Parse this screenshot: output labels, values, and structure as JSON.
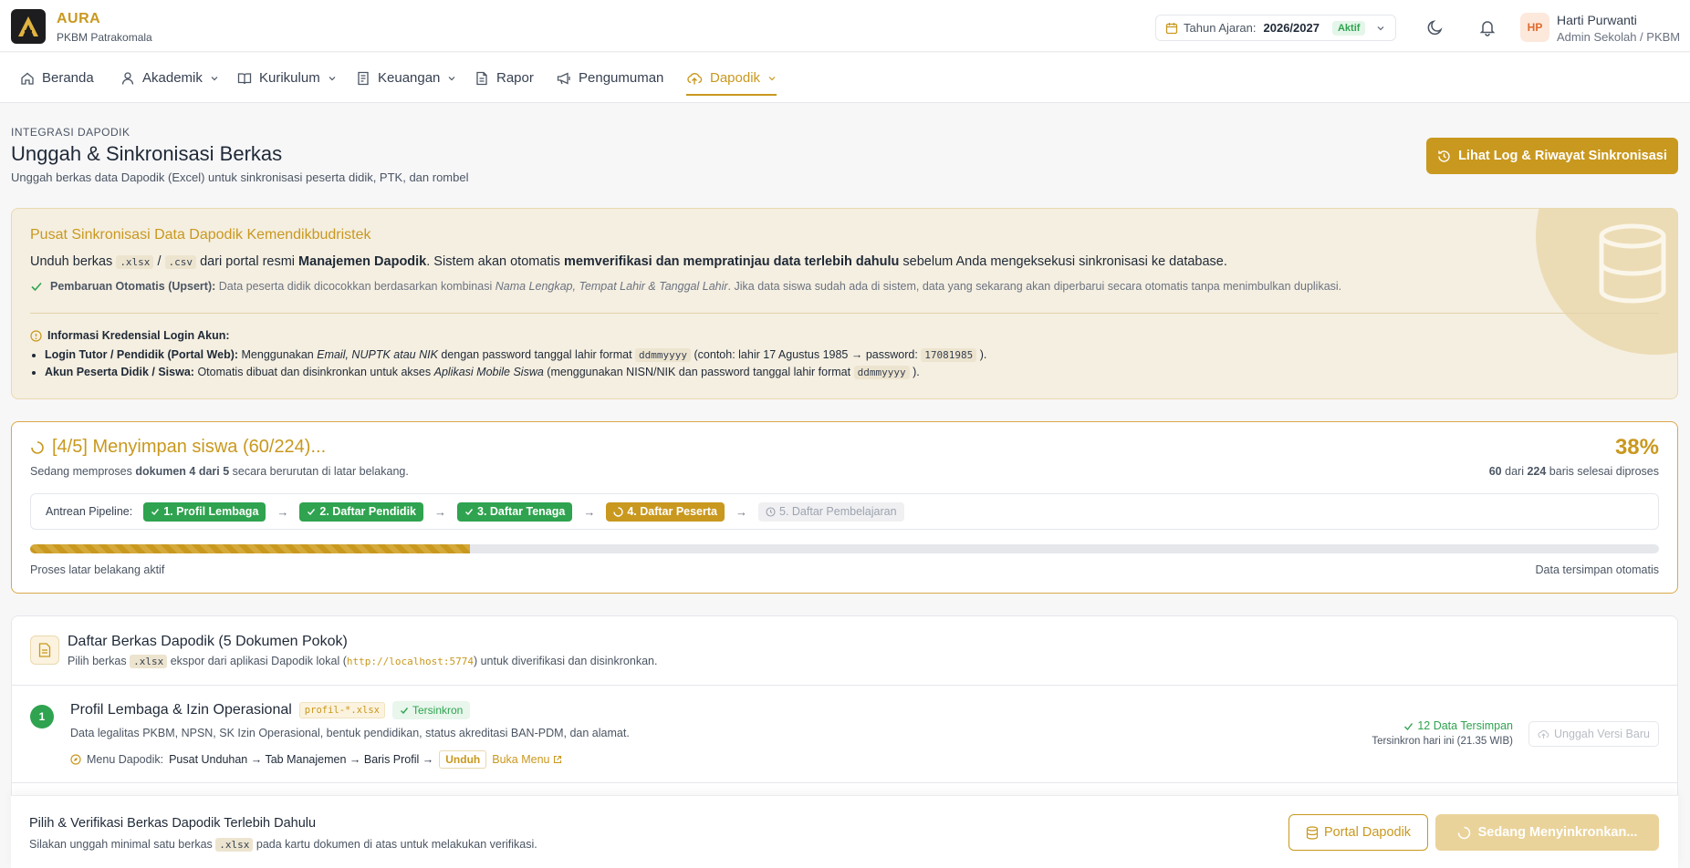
{
  "brand": {
    "name": "AURA",
    "org": "PKBM Patrakomala"
  },
  "academic_year": {
    "label": "Tahun Ajaran:",
    "value": "2026/2027",
    "status": "Aktif"
  },
  "user": {
    "initials": "HP",
    "name": "Harti Purwanti",
    "role": "Admin Sekolah / PKBM"
  },
  "nav": [
    {
      "label": "Beranda",
      "icon": "home-icon"
    },
    {
      "label": "Akademik",
      "icon": "user-icon"
    },
    {
      "label": "Kurikulum",
      "icon": "book-icon"
    },
    {
      "label": "Keuangan",
      "icon": "receipt-icon"
    },
    {
      "label": "Rapor",
      "icon": "document-icon"
    },
    {
      "label": "Pengumuman",
      "icon": "megaphone-icon"
    },
    {
      "label": "Dapodik",
      "icon": "cloud-upload-icon",
      "active": true
    }
  ],
  "page": {
    "eyebrow": "INTEGRASI DAPODIK",
    "title": "Unggah & Sinkronisasi Berkas",
    "subtitle": "Unggah berkas data Dapodik (Excel) untuk sinkronisasi peserta didik, PTK, dan rombel",
    "log_button": "Lihat Log & Riwayat Sinkronisasi"
  },
  "info": {
    "title": "Pusat Sinkronisasi Data Dapodik Kemendikbudristek",
    "line1_a": "Unduh berkas",
    "ext_xlsx": ".xlsx",
    "slash": "/",
    "ext_csv": ".csv",
    "line1_b": "dari portal resmi",
    "line1_c": "Manajemen Dapodik",
    "line1_d": ". Sistem akan otomatis",
    "line1_e": "memverifikasi dan mempratinjau data terlebih dahulu",
    "line1_f": "sebelum Anda mengeksekusi sinkronisasi ke database.",
    "upsert_label": "Pembaruan Otomatis (Upsert):",
    "upsert_a": "Data peserta didik dicocokkan berdasarkan kombinasi",
    "upsert_b": "Nama Lengkap, Tempat Lahir & Tanggal Lahir",
    "upsert_c": ". Jika data siswa sudah ada di sistem, data yang sekarang akan diperbarui secara otomatis tanpa menimbulkan duplikasi.",
    "cred_title": "Informasi Kredensial Login Akun:",
    "tutor_label": "Login Tutor / Pendidik (Portal Web):",
    "tutor_a": "Menggunakan",
    "tutor_b": "Email, NUPTK atau NIK",
    "tutor_c": "dengan password tanggal lahir format",
    "tutor_fmt": "ddmmyyyy",
    "tutor_d": "(contoh: lahir 17 Agustus 1985 → password:",
    "tutor_ex": "17081985",
    "tutor_e": ").",
    "student_label": "Akun Peserta Didik / Siswa:",
    "student_a": "Otomatis dibuat dan disinkronkan untuk akses",
    "student_b": "Aplikasi Mobile Siswa",
    "student_c": "(menggunakan NISN/NIK dan password tanggal lahir format",
    "student_fmt": "ddmmyyyy",
    "student_d": ")."
  },
  "progress": {
    "title": "[4/5] Menyimpan siswa (60/224)...",
    "sub_a": "Sedang memproses",
    "sub_b": "dokumen 4 dari 5",
    "sub_c": "secara berurutan di latar belakang.",
    "percent_label": "38%",
    "percent": 0.27,
    "rows_done": "60",
    "rows_mid": "dari",
    "rows_total": "224",
    "rows_tail": "baris selesai diproses",
    "pipeline_label": "Antrean Pipeline:",
    "steps": [
      {
        "label": "1. Profil Lembaga",
        "state": "done"
      },
      {
        "label": "2. Daftar Pendidik",
        "state": "done"
      },
      {
        "label": "3. Daftar Tenaga",
        "state": "done"
      },
      {
        "label": "4. Daftar Peserta",
        "state": "current"
      },
      {
        "label": "5. Daftar Pembelajaran",
        "state": "waiting"
      }
    ],
    "footer_left": "Proses latar belakang aktif",
    "footer_right": "Data tersimpan otomatis"
  },
  "files": {
    "title": "Daftar Berkas Dapodik (5 Dokumen Pokok)",
    "sub_a": "Pilih berkas",
    "sub_ext": ".xlsx",
    "sub_b": "ekspor dari aplikasi Dapodik lokal (",
    "sub_url": "http://localhost:5774",
    "sub_c": ") untuk diverifikasi dan disinkronkan.",
    "items": [
      {
        "num": "1",
        "name": "Profil Lembaga & Izin Operasional",
        "pattern": "profil-*.xlsx",
        "status": "Tersinkron",
        "desc": "Data legalitas PKBM, NPSN, SK Izin Operasional, bentuk pendidikan, status akreditasi BAN-PDM, dan alamat.",
        "menu_label": "Menu Dapodik:",
        "menu_path": "Pusat Unduhan → Tab Manajemen → Baris Profil →",
        "menu_download": "Unduh",
        "menu_open": "Buka Menu",
        "saved": "12 Data Tersimpan",
        "synced_at": "Tersinkron hari ini (21.35 WIB)",
        "upload_button": "Unggah Versi Baru"
      }
    ]
  },
  "footer": {
    "title": "Pilih & Verifikasi Berkas Dapodik Terlebih Dahulu",
    "sub_a": "Silakan unggah minimal satu berkas",
    "sub_ext": ".xlsx",
    "sub_b": "pada kartu dokumen di atas untuk melakukan verifikasi.",
    "portal_button": "Portal Dapodik",
    "sync_button": "Sedang Menyinkronkan..."
  },
  "colors": {
    "accent": "#c9981e",
    "success": "#2fa34f"
  }
}
